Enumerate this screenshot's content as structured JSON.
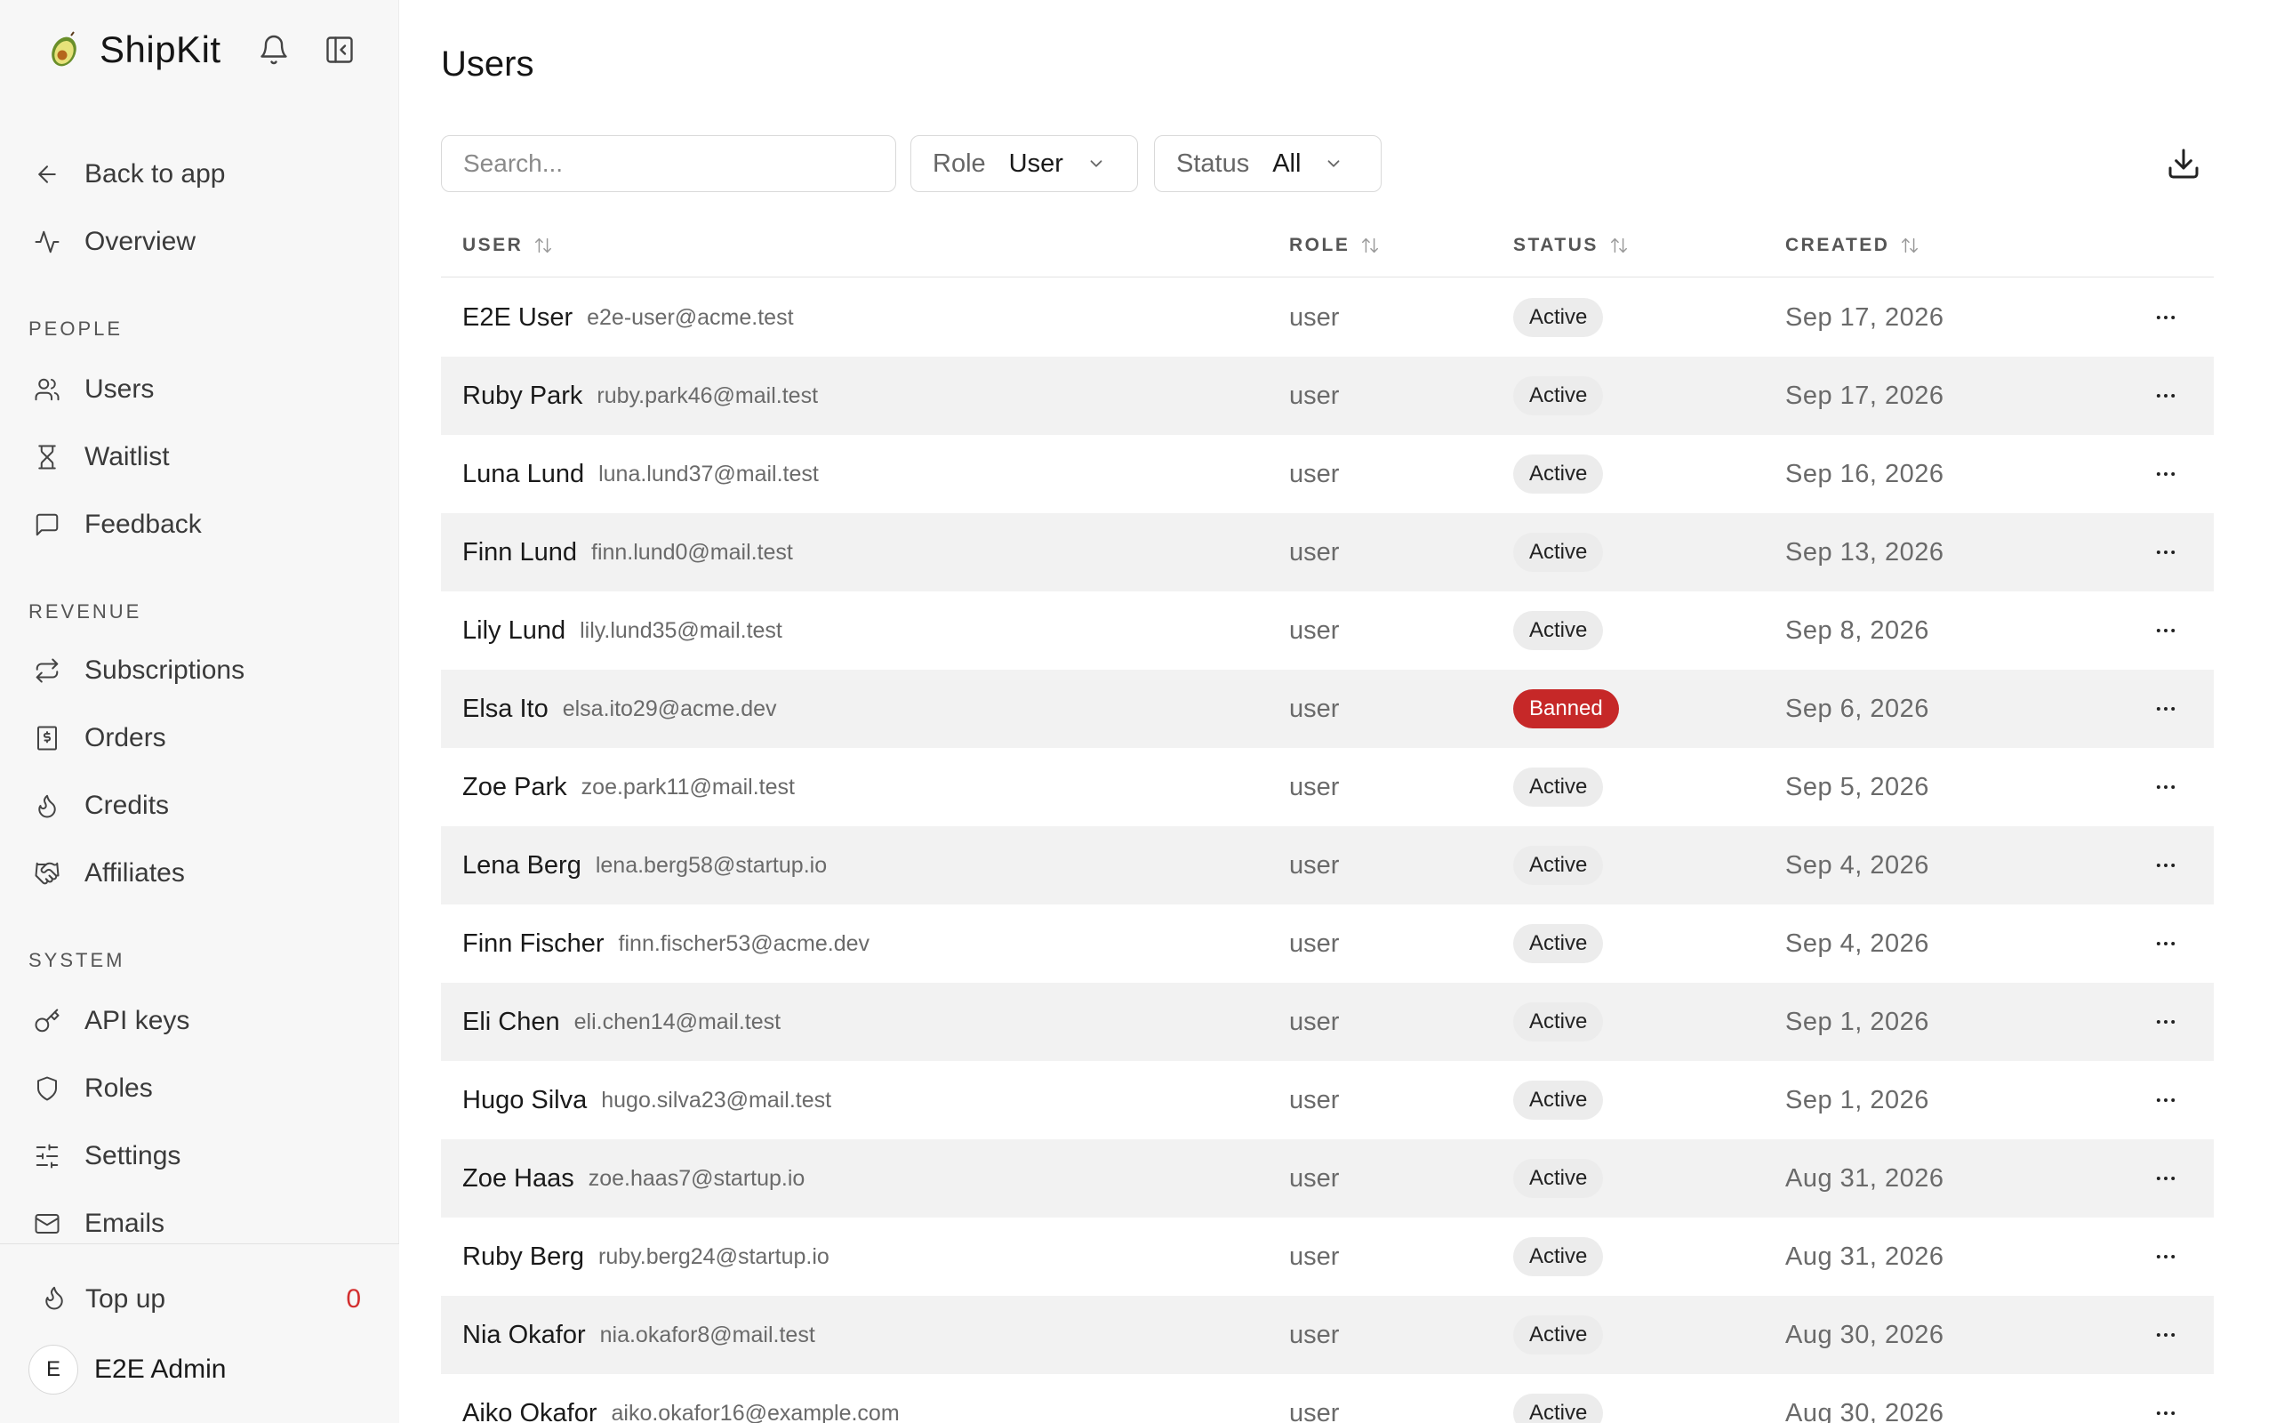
{
  "app": {
    "name": "ShipKit",
    "icons": {
      "logo": "avocado-logo",
      "notifications": "bell-icon",
      "collapse": "sidebar-collapse-icon"
    }
  },
  "sidebar": {
    "top_items": [
      {
        "label": "Back to app",
        "icon": "arrow-left-icon"
      },
      {
        "label": "Overview",
        "icon": "activity-icon"
      }
    ],
    "sections": [
      {
        "title": "PEOPLE",
        "items": [
          {
            "label": "Users",
            "icon": "users-icon"
          },
          {
            "label": "Waitlist",
            "icon": "hourglass-icon"
          },
          {
            "label": "Feedback",
            "icon": "message-square-icon"
          }
        ]
      },
      {
        "title": "REVENUE",
        "items": [
          {
            "label": "Subscriptions",
            "icon": "repeat-icon"
          },
          {
            "label": "Orders",
            "icon": "receipt-icon"
          },
          {
            "label": "Credits",
            "icon": "flame-icon"
          },
          {
            "label": "Affiliates",
            "icon": "handshake-icon"
          }
        ]
      },
      {
        "title": "SYSTEM",
        "items": [
          {
            "label": "API keys",
            "icon": "key-icon"
          },
          {
            "label": "Roles",
            "icon": "shield-icon"
          },
          {
            "label": "Settings",
            "icon": "sliders-icon"
          },
          {
            "label": "Emails",
            "icon": "mail-icon"
          }
        ]
      }
    ],
    "footer": {
      "topup_label": "Top up",
      "topup_count": "0",
      "user_initial": "E",
      "user_name": "E2E Admin"
    }
  },
  "main": {
    "title": "Users",
    "search_placeholder": "Search...",
    "filters": {
      "role": {
        "label": "Role",
        "value": "User"
      },
      "status": {
        "label": "Status",
        "value": "All"
      }
    },
    "columns": {
      "user": "USER",
      "role": "ROLE",
      "status": "STATUS",
      "created": "CREATED"
    },
    "rows": [
      {
        "name": "E2E User",
        "email": "e2e-user@acme.test",
        "role": "user",
        "status": "Active",
        "created": "Sep 17, 2026"
      },
      {
        "name": "Ruby Park",
        "email": "ruby.park46@mail.test",
        "role": "user",
        "status": "Active",
        "created": "Sep 17, 2026"
      },
      {
        "name": "Luna Lund",
        "email": "luna.lund37@mail.test",
        "role": "user",
        "status": "Active",
        "created": "Sep 16, 2026"
      },
      {
        "name": "Finn Lund",
        "email": "finn.lund0@mail.test",
        "role": "user",
        "status": "Active",
        "created": "Sep 13, 2026"
      },
      {
        "name": "Lily Lund",
        "email": "lily.lund35@mail.test",
        "role": "user",
        "status": "Active",
        "created": "Sep 8, 2026"
      },
      {
        "name": "Elsa Ito",
        "email": "elsa.ito29@acme.dev",
        "role": "user",
        "status": "Banned",
        "created": "Sep 6, 2026"
      },
      {
        "name": "Zoe Park",
        "email": "zoe.park11@mail.test",
        "role": "user",
        "status": "Active",
        "created": "Sep 5, 2026"
      },
      {
        "name": "Lena Berg",
        "email": "lena.berg58@startup.io",
        "role": "user",
        "status": "Active",
        "created": "Sep 4, 2026"
      },
      {
        "name": "Finn Fischer",
        "email": "finn.fischer53@acme.dev",
        "role": "user",
        "status": "Active",
        "created": "Sep 4, 2026"
      },
      {
        "name": "Eli Chen",
        "email": "eli.chen14@mail.test",
        "role": "user",
        "status": "Active",
        "created": "Sep 1, 2026"
      },
      {
        "name": "Hugo Silva",
        "email": "hugo.silva23@mail.test",
        "role": "user",
        "status": "Active",
        "created": "Sep 1, 2026"
      },
      {
        "name": "Zoe Haas",
        "email": "zoe.haas7@startup.io",
        "role": "user",
        "status": "Active",
        "created": "Aug 31, 2026"
      },
      {
        "name": "Ruby Berg",
        "email": "ruby.berg24@startup.io",
        "role": "user",
        "status": "Active",
        "created": "Aug 31, 2026"
      },
      {
        "name": "Nia Okafor",
        "email": "nia.okafor8@mail.test",
        "role": "user",
        "status": "Active",
        "created": "Aug 30, 2026"
      },
      {
        "name": "Aiko Okafor",
        "email": "aiko.okafor16@example.com",
        "role": "user",
        "status": "Active",
        "created": "Aug 30, 2026"
      }
    ]
  },
  "colors": {
    "sidebar_bg": "#f7f7f7",
    "row_alt_bg": "#f2f2f2",
    "badge_active_bg": "#ececec",
    "badge_banned_bg": "#c62828",
    "topup_count": "#d32f2f"
  }
}
